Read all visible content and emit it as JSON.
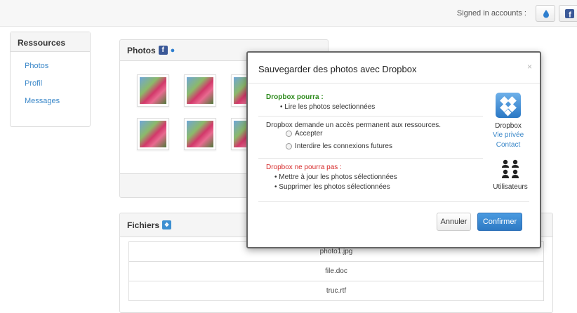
{
  "topbar": {
    "signed_label": "Signed in accounts :"
  },
  "sidebar": {
    "title": "Ressources",
    "items": [
      {
        "label": "Photos"
      },
      {
        "label": "Profil"
      },
      {
        "label": "Messages"
      }
    ]
  },
  "photos_panel": {
    "title": "Photos"
  },
  "files_panel": {
    "title": "Fichiers",
    "files": [
      {
        "name": "photo1.jpg"
      },
      {
        "name": "file.doc"
      },
      {
        "name": "truc.rtf"
      }
    ]
  },
  "modal": {
    "title": "Sauvegarder des photos avec Dropbox",
    "close": "×",
    "can_title": "Dropbox pourra :",
    "can_items": [
      "Lire les photos selectionnées"
    ],
    "request_text": "Dropbox demande un accès permanent aux ressources.",
    "options": [
      {
        "label": "Accepter"
      },
      {
        "label": "Interdire les connexions futures"
      }
    ],
    "cannot_title": "Dropbox ne pourra pas :",
    "cannot_items": [
      "Mettre à jour les photos sélectionnées",
      "Supprimer les photos sélectionnées"
    ],
    "app_name": "Dropbox",
    "privacy_link": "Vie privée",
    "contact_link": "Contact",
    "users_label": "Utilisateurs",
    "cancel_label": "Annuler",
    "confirm_label": "Confirmer"
  },
  "colors": {
    "link": "#3a87c8",
    "green": "#2c8a1b",
    "red": "#d62a2a",
    "primary": "#2e7ac4"
  },
  "icons": {
    "dropbox": "dropbox-icon",
    "facebook": "facebook-icon",
    "users": "users-icon"
  }
}
